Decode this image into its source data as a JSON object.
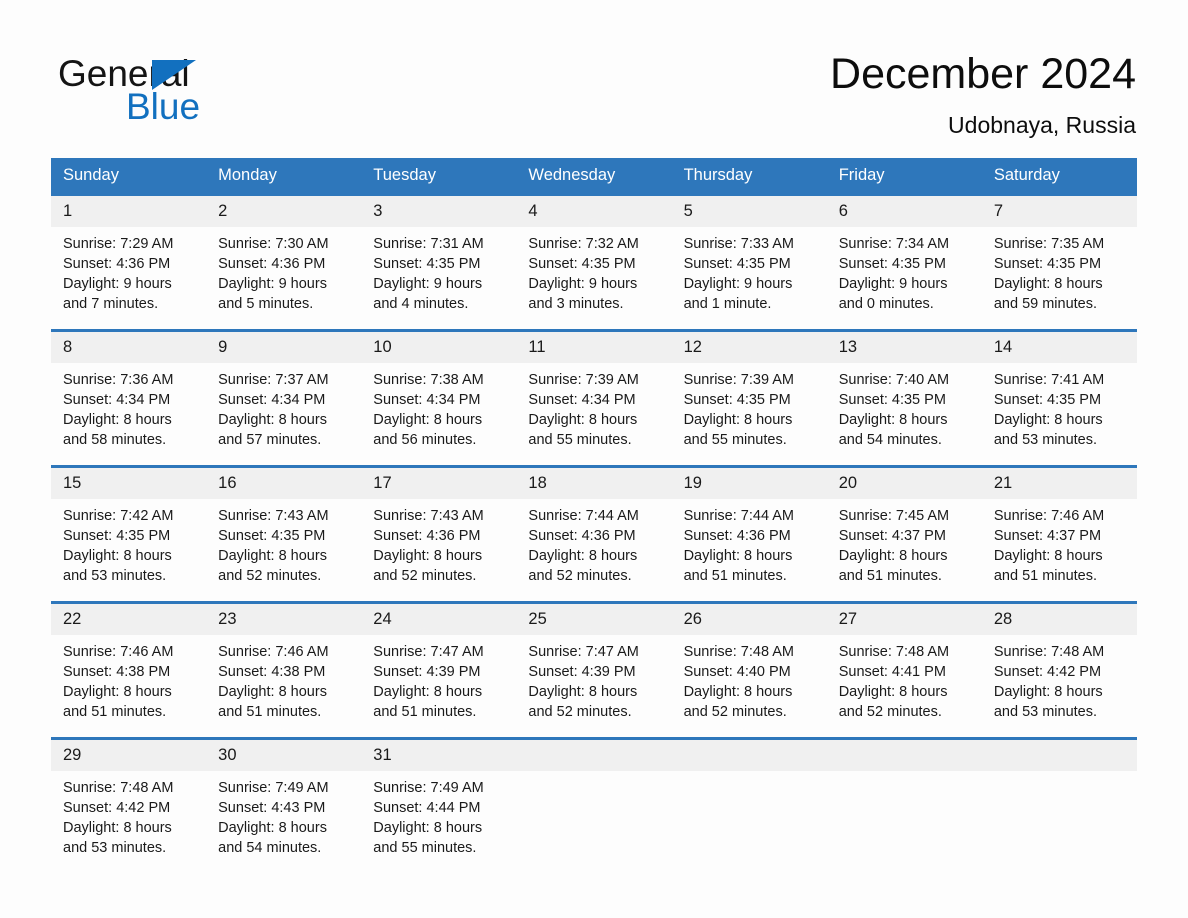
{
  "brand": {
    "name_top": "General",
    "name_bottom": "Blue",
    "triangle_icon": "blue-triangle-icon",
    "color_black": "#141414",
    "color_blue": "#1270bf"
  },
  "header": {
    "title": "December 2024",
    "location": "Udobnaya, Russia"
  },
  "theme": {
    "header_blue": "#2e77bb",
    "day_band_gray": "#f0f0f0",
    "page_background": "#fdfdfd"
  },
  "weekdays": [
    "Sunday",
    "Monday",
    "Tuesday",
    "Wednesday",
    "Thursday",
    "Friday",
    "Saturday"
  ],
  "weeks": [
    [
      {
        "day": "1",
        "sunrise": "Sunrise: 7:29 AM",
        "sunset": "Sunset: 4:36 PM",
        "daylight1": "Daylight: 9 hours",
        "daylight2": "and 7 minutes."
      },
      {
        "day": "2",
        "sunrise": "Sunrise: 7:30 AM",
        "sunset": "Sunset: 4:36 PM",
        "daylight1": "Daylight: 9 hours",
        "daylight2": "and 5 minutes."
      },
      {
        "day": "3",
        "sunrise": "Sunrise: 7:31 AM",
        "sunset": "Sunset: 4:35 PM",
        "daylight1": "Daylight: 9 hours",
        "daylight2": "and 4 minutes."
      },
      {
        "day": "4",
        "sunrise": "Sunrise: 7:32 AM",
        "sunset": "Sunset: 4:35 PM",
        "daylight1": "Daylight: 9 hours",
        "daylight2": "and 3 minutes."
      },
      {
        "day": "5",
        "sunrise": "Sunrise: 7:33 AM",
        "sunset": "Sunset: 4:35 PM",
        "daylight1": "Daylight: 9 hours",
        "daylight2": "and 1 minute."
      },
      {
        "day": "6",
        "sunrise": "Sunrise: 7:34 AM",
        "sunset": "Sunset: 4:35 PM",
        "daylight1": "Daylight: 9 hours",
        "daylight2": "and 0 minutes."
      },
      {
        "day": "7",
        "sunrise": "Sunrise: 7:35 AM",
        "sunset": "Sunset: 4:35 PM",
        "daylight1": "Daylight: 8 hours",
        "daylight2": "and 59 minutes."
      }
    ],
    [
      {
        "day": "8",
        "sunrise": "Sunrise: 7:36 AM",
        "sunset": "Sunset: 4:34 PM",
        "daylight1": "Daylight: 8 hours",
        "daylight2": "and 58 minutes."
      },
      {
        "day": "9",
        "sunrise": "Sunrise: 7:37 AM",
        "sunset": "Sunset: 4:34 PM",
        "daylight1": "Daylight: 8 hours",
        "daylight2": "and 57 minutes."
      },
      {
        "day": "10",
        "sunrise": "Sunrise: 7:38 AM",
        "sunset": "Sunset: 4:34 PM",
        "daylight1": "Daylight: 8 hours",
        "daylight2": "and 56 minutes."
      },
      {
        "day": "11",
        "sunrise": "Sunrise: 7:39 AM",
        "sunset": "Sunset: 4:34 PM",
        "daylight1": "Daylight: 8 hours",
        "daylight2": "and 55 minutes."
      },
      {
        "day": "12",
        "sunrise": "Sunrise: 7:39 AM",
        "sunset": "Sunset: 4:35 PM",
        "daylight1": "Daylight: 8 hours",
        "daylight2": "and 55 minutes."
      },
      {
        "day": "13",
        "sunrise": "Sunrise: 7:40 AM",
        "sunset": "Sunset: 4:35 PM",
        "daylight1": "Daylight: 8 hours",
        "daylight2": "and 54 minutes."
      },
      {
        "day": "14",
        "sunrise": "Sunrise: 7:41 AM",
        "sunset": "Sunset: 4:35 PM",
        "daylight1": "Daylight: 8 hours",
        "daylight2": "and 53 minutes."
      }
    ],
    [
      {
        "day": "15",
        "sunrise": "Sunrise: 7:42 AM",
        "sunset": "Sunset: 4:35 PM",
        "daylight1": "Daylight: 8 hours",
        "daylight2": "and 53 minutes."
      },
      {
        "day": "16",
        "sunrise": "Sunrise: 7:43 AM",
        "sunset": "Sunset: 4:35 PM",
        "daylight1": "Daylight: 8 hours",
        "daylight2": "and 52 minutes."
      },
      {
        "day": "17",
        "sunrise": "Sunrise: 7:43 AM",
        "sunset": "Sunset: 4:36 PM",
        "daylight1": "Daylight: 8 hours",
        "daylight2": "and 52 minutes."
      },
      {
        "day": "18",
        "sunrise": "Sunrise: 7:44 AM",
        "sunset": "Sunset: 4:36 PM",
        "daylight1": "Daylight: 8 hours",
        "daylight2": "and 52 minutes."
      },
      {
        "day": "19",
        "sunrise": "Sunrise: 7:44 AM",
        "sunset": "Sunset: 4:36 PM",
        "daylight1": "Daylight: 8 hours",
        "daylight2": "and 51 minutes."
      },
      {
        "day": "20",
        "sunrise": "Sunrise: 7:45 AM",
        "sunset": "Sunset: 4:37 PM",
        "daylight1": "Daylight: 8 hours",
        "daylight2": "and 51 minutes."
      },
      {
        "day": "21",
        "sunrise": "Sunrise: 7:46 AM",
        "sunset": "Sunset: 4:37 PM",
        "daylight1": "Daylight: 8 hours",
        "daylight2": "and 51 minutes."
      }
    ],
    [
      {
        "day": "22",
        "sunrise": "Sunrise: 7:46 AM",
        "sunset": "Sunset: 4:38 PM",
        "daylight1": "Daylight: 8 hours",
        "daylight2": "and 51 minutes."
      },
      {
        "day": "23",
        "sunrise": "Sunrise: 7:46 AM",
        "sunset": "Sunset: 4:38 PM",
        "daylight1": "Daylight: 8 hours",
        "daylight2": "and 51 minutes."
      },
      {
        "day": "24",
        "sunrise": "Sunrise: 7:47 AM",
        "sunset": "Sunset: 4:39 PM",
        "daylight1": "Daylight: 8 hours",
        "daylight2": "and 51 minutes."
      },
      {
        "day": "25",
        "sunrise": "Sunrise: 7:47 AM",
        "sunset": "Sunset: 4:39 PM",
        "daylight1": "Daylight: 8 hours",
        "daylight2": "and 52 minutes."
      },
      {
        "day": "26",
        "sunrise": "Sunrise: 7:48 AM",
        "sunset": "Sunset: 4:40 PM",
        "daylight1": "Daylight: 8 hours",
        "daylight2": "and 52 minutes."
      },
      {
        "day": "27",
        "sunrise": "Sunrise: 7:48 AM",
        "sunset": "Sunset: 4:41 PM",
        "daylight1": "Daylight: 8 hours",
        "daylight2": "and 52 minutes."
      },
      {
        "day": "28",
        "sunrise": "Sunrise: 7:48 AM",
        "sunset": "Sunset: 4:42 PM",
        "daylight1": "Daylight: 8 hours",
        "daylight2": "and 53 minutes."
      }
    ],
    [
      {
        "day": "29",
        "sunrise": "Sunrise: 7:48 AM",
        "sunset": "Sunset: 4:42 PM",
        "daylight1": "Daylight: 8 hours",
        "daylight2": "and 53 minutes."
      },
      {
        "day": "30",
        "sunrise": "Sunrise: 7:49 AM",
        "sunset": "Sunset: 4:43 PM",
        "daylight1": "Daylight: 8 hours",
        "daylight2": "and 54 minutes."
      },
      {
        "day": "31",
        "sunrise": "Sunrise: 7:49 AM",
        "sunset": "Sunset: 4:44 PM",
        "daylight1": "Daylight: 8 hours",
        "daylight2": "and 55 minutes."
      },
      {
        "day": "",
        "sunrise": "",
        "sunset": "",
        "daylight1": "",
        "daylight2": ""
      },
      {
        "day": "",
        "sunrise": "",
        "sunset": "",
        "daylight1": "",
        "daylight2": ""
      },
      {
        "day": "",
        "sunrise": "",
        "sunset": "",
        "daylight1": "",
        "daylight2": ""
      },
      {
        "day": "",
        "sunrise": "",
        "sunset": "",
        "daylight1": "",
        "daylight2": ""
      }
    ]
  ]
}
